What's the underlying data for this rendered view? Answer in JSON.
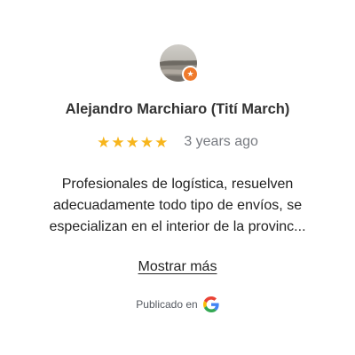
{
  "reviewer": {
    "name": "Alejandro Marchiaro (Tití March)",
    "avatar_icon": "avatar-photo",
    "badge_icon": "local-guide-star-icon",
    "badge_color": "#ef7a2c"
  },
  "review": {
    "rating": 5,
    "rating_max": 5,
    "star_color": "#f7b51c",
    "date": "3 years ago",
    "text_lines": [
      "Profesionales de logística, resuelven",
      "adecuadamente todo tipo de envíos, se",
      "especializan en el interior de la provinc..."
    ],
    "show_more_label": "Mostrar más"
  },
  "footer": {
    "published_label": "Publicado en",
    "source_icon": "google-logo-icon"
  }
}
